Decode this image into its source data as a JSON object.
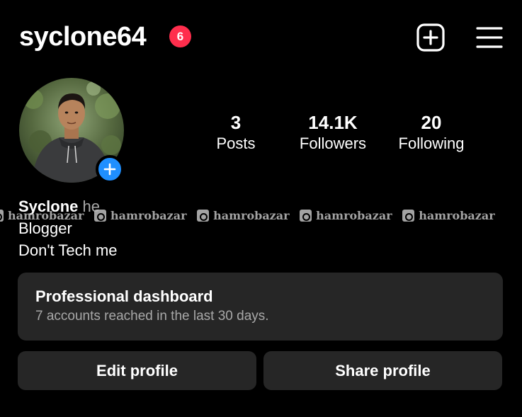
{
  "header": {
    "username": "syclone64",
    "notification_count": "6",
    "create_icon": "plus-square-icon",
    "menu_icon": "hamburger-menu-icon"
  },
  "profile": {
    "stats": [
      {
        "value": "3",
        "label": "Posts"
      },
      {
        "value": "14.1K",
        "label": "Followers"
      },
      {
        "value": "20",
        "label": "Following"
      }
    ],
    "bio": {
      "name": "Syclone",
      "pronouns": "he",
      "lines": [
        "Blogger",
        "Don't Tech me"
      ]
    }
  },
  "watermark": {
    "text": "hamrobazar",
    "repeat_labels": [
      "hamrobazar",
      "hamrobazar",
      "hamrobazar",
      "hamrobazar",
      "hamrobazar"
    ]
  },
  "dashboard": {
    "title": "Professional dashboard",
    "subtitle": "7 accounts reached in the last 30 days."
  },
  "actions": {
    "edit_label": "Edit profile",
    "share_label": "Share profile"
  },
  "colors": {
    "background": "#000000",
    "badge": "#ff2e4d",
    "add_story": "#1f8fff",
    "card": "#262626",
    "secondary_text": "#a8a8a8"
  }
}
